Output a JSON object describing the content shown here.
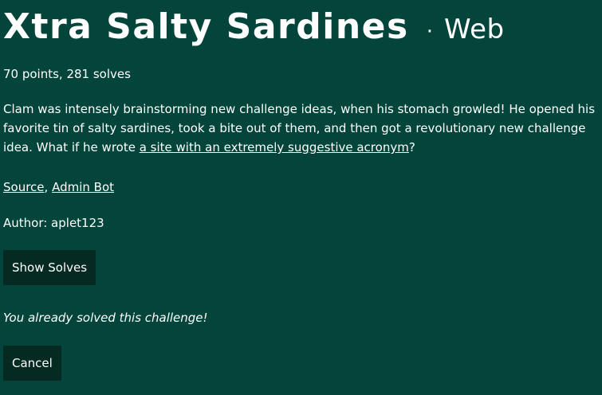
{
  "challenge": {
    "title": "Xtra Salty Sardines",
    "separator": "·",
    "category": "Web",
    "points_solves": "70 points, 281 solves",
    "description_before_link": "Clam was intensely brainstorming new challenge ideas, when his stomach growled! He opened his favorite tin of salty sardines, took a bite out of them, and then got a revolutionary new challenge idea. What if he wrote ",
    "description_link": "a site with an extremely suggestive acronym",
    "description_after_link": "?",
    "links": [
      {
        "label": "Source"
      },
      {
        "label": "Admin Bot"
      }
    ],
    "links_separator": ", ",
    "author": "Author: aplet123",
    "solved_message": "You already solved this challenge!"
  },
  "buttons": {
    "show_solves": "Show Solves",
    "cancel": "Cancel"
  },
  "colors": {
    "background": "#03453a",
    "button_background": "#052a22",
    "text": "#ffffff"
  }
}
